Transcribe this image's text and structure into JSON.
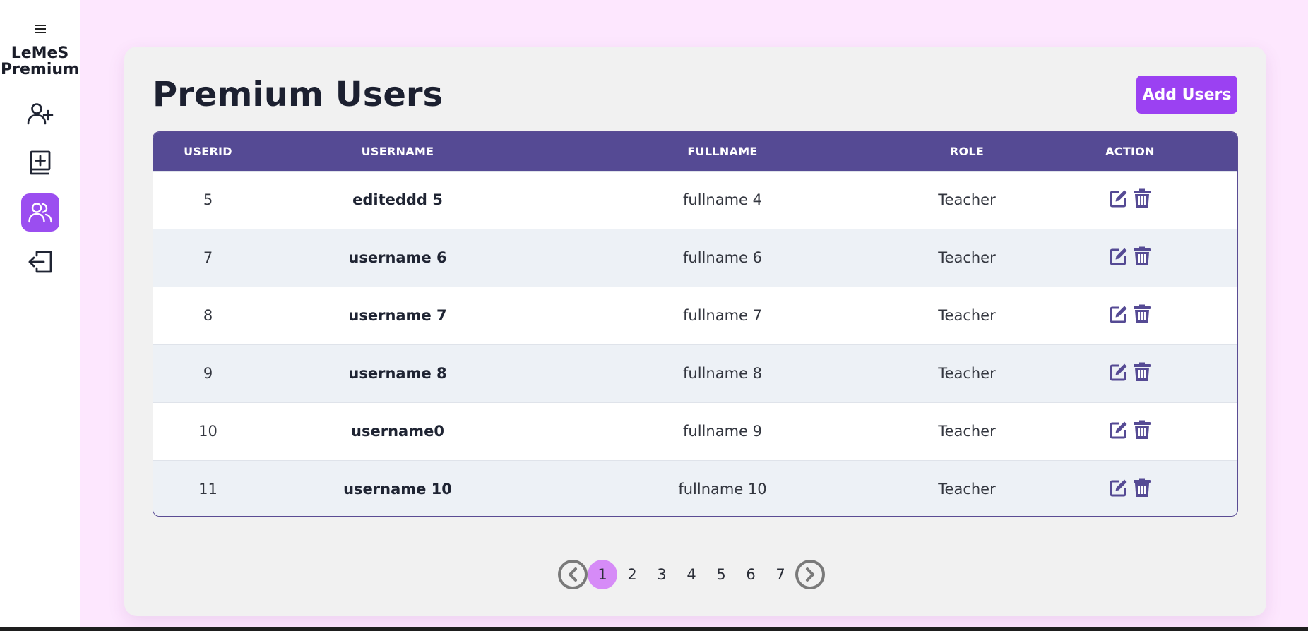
{
  "sidebar": {
    "brand_line1": "LeMeS",
    "brand_line2": "Premium",
    "menu_icon": "hamburger-menu-icon",
    "items": [
      {
        "icon": "user-plus-icon",
        "active": false
      },
      {
        "icon": "book-add-icon",
        "active": false
      },
      {
        "icon": "users-icon",
        "active": true
      },
      {
        "icon": "logout-icon",
        "active": false
      }
    ]
  },
  "page": {
    "title": "Premium Users",
    "add_button": "Add Users"
  },
  "table": {
    "headers": {
      "userid": "USERID",
      "username": "USERNAME",
      "fullname": "FULLNAME",
      "role": "ROLE",
      "action": "ACTION"
    },
    "rows": [
      {
        "userid": "5",
        "username": "editeddd 5",
        "fullname": "fullname 4",
        "role": "Teacher"
      },
      {
        "userid": "7",
        "username": "username 6",
        "fullname": "fullname 6",
        "role": "Teacher"
      },
      {
        "userid": "8",
        "username": "username 7",
        "fullname": "fullname 7",
        "role": "Teacher"
      },
      {
        "userid": "9",
        "username": "username 8",
        "fullname": "fullname 8",
        "role": "Teacher"
      },
      {
        "userid": "10",
        "username": "username0",
        "fullname": "fullname 9",
        "role": "Teacher"
      },
      {
        "userid": "11",
        "username": "username 10",
        "fullname": "fullname 10",
        "role": "Teacher"
      }
    ]
  },
  "pagination": {
    "pages": [
      "1",
      "2",
      "3",
      "4",
      "5",
      "6",
      "7"
    ],
    "current": "1"
  },
  "colors": {
    "background": "#fde7fe",
    "accent": "#9b41f2",
    "header": "#554a94",
    "active_page": "#d68bf7"
  }
}
